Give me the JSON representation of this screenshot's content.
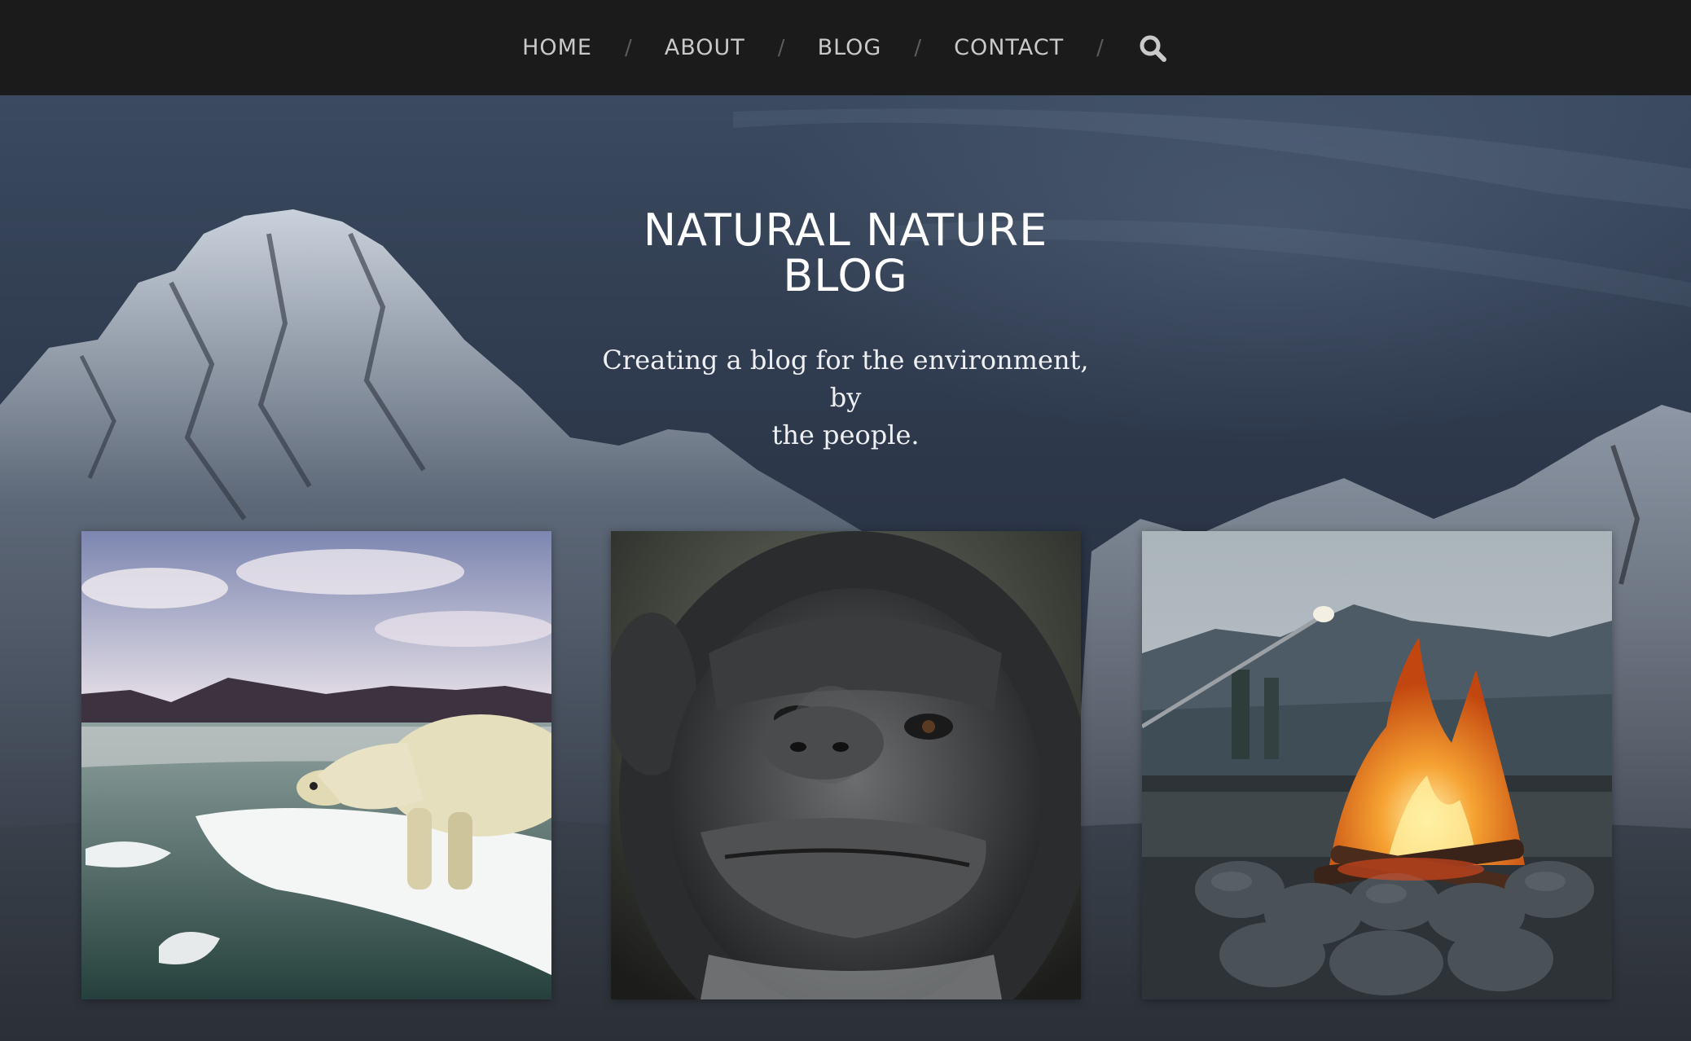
{
  "nav": {
    "items": [
      {
        "label": "HOME"
      },
      {
        "label": "ABOUT"
      },
      {
        "label": "BLOG"
      },
      {
        "label": "CONTACT"
      }
    ],
    "separator": "/",
    "search_icon": "search-icon"
  },
  "hero": {
    "title_line1": "NATURAL NATURE",
    "title_line2": "BLOG",
    "tagline_line1": "Creating a blog for the environment, by",
    "tagline_line2": "the people.",
    "background": "snowy-mountain-night-sky"
  },
  "featured": [
    {
      "image": "polar-bear-on-ice-floe"
    },
    {
      "image": "chimpanzee-face-closeup"
    },
    {
      "image": "campfire-with-marshmallow-stick"
    }
  ],
  "colors": {
    "nav_bg": "#1b1b1b",
    "nav_text": "#c9c9c9",
    "nav_separator": "#5c5c5c",
    "hero_text": "#ffffff"
  }
}
